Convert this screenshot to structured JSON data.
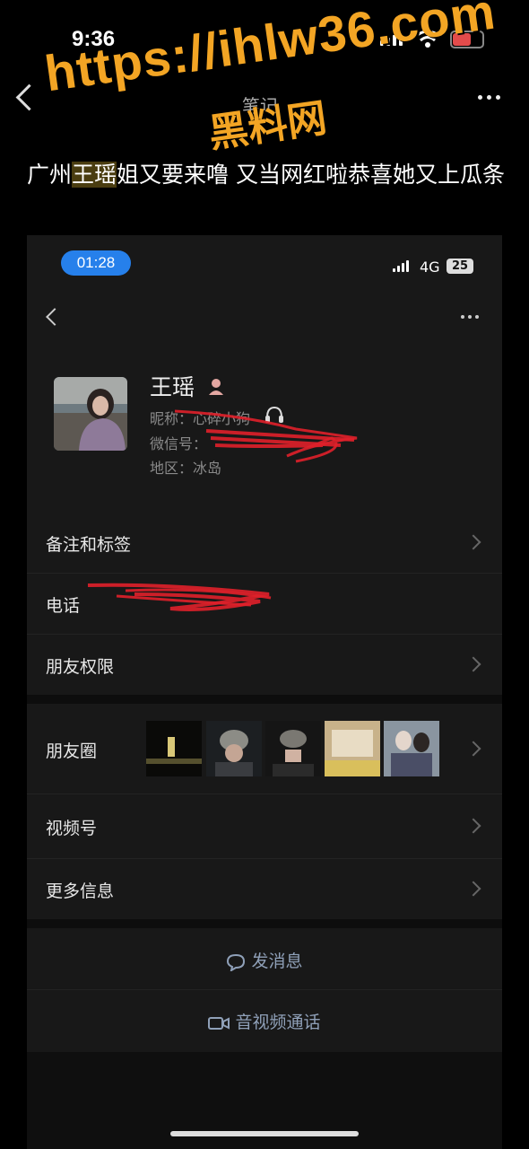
{
  "outer_status": {
    "time": "9:36"
  },
  "outer_nav": {
    "title": "笔记"
  },
  "post": {
    "title_before": "广州",
    "title_highlight": "王瑶",
    "title_after": "姐又要来噜 又当网红啦恭喜她又上瓜条"
  },
  "watermark": {
    "url": "https://ihlw36.com",
    "name": "黑料网"
  },
  "inner_status": {
    "time": "01:28",
    "network": "4G",
    "battery": "25"
  },
  "profile": {
    "name": "王瑶",
    "nickname_label": "昵称：",
    "nickname": "心碎小狗",
    "wechat_id_label": "微信号：",
    "region_label": "地区：",
    "region": "冰岛"
  },
  "rows": {
    "remarks_tags": "备注和标签",
    "phone": "电话",
    "friend_permissions": "朋友权限",
    "moments": "朋友圈",
    "channels": "视频号",
    "more_info": "更多信息"
  },
  "actions": {
    "message": "发消息",
    "call": "音视频通话"
  },
  "colors": {
    "accent_blue": "#2680eb",
    "watermark_orange": "#f3a524",
    "redaction_red": "#e0202a"
  }
}
